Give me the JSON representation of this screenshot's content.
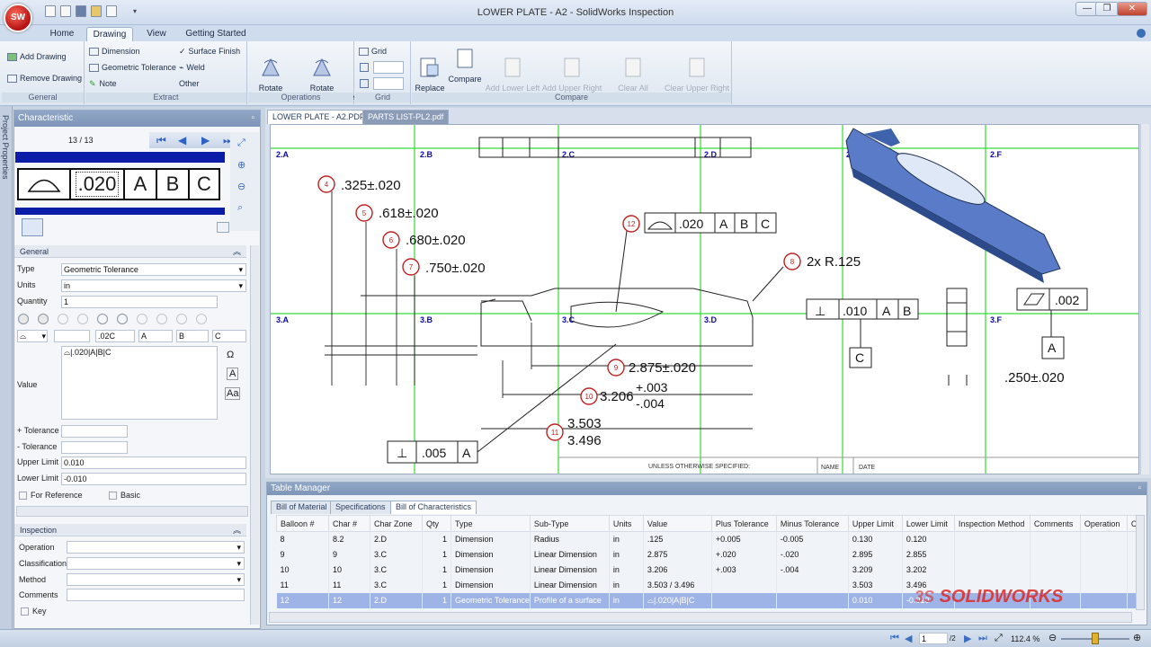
{
  "window": {
    "title": "LOWER PLATE - A2 - SolidWorks Inspection",
    "logo_text": "SW",
    "min": "—",
    "max": "❐",
    "close": "✕"
  },
  "ribbon": {
    "tabs": [
      "Home",
      "Drawing",
      "View",
      "Getting Started"
    ],
    "active_tab": "Drawing",
    "general": {
      "label": "General",
      "add_drawing": "Add Drawing",
      "remove_drawing": "Remove Drawing"
    },
    "extract": {
      "label": "Extract",
      "dimension": "Dimension",
      "geometric_tolerance": "Geometric Tolerance",
      "note": "Note",
      "surface_finish": "Surface Finish",
      "weld": "Weld",
      "other": "Other"
    },
    "operations": {
      "label": "Operations",
      "rotate_cw": "Rotate\nClockwise",
      "rotate_ccw": "Rotate\nCounterclockwise"
    },
    "grid": {
      "label": "Grid",
      "grid": "Grid"
    },
    "compare": {
      "label": "Compare",
      "replace_drawing": "Replace\nDrawing",
      "compare": "Compare",
      "add_lower_left": "Add Lower Left\nAlignment Point",
      "add_upper_right": "Add Upper Right\nAlignment Point",
      "clear_all": "Clear All\nAlignment Points",
      "clear_upper_right": "Clear Upper Right\nAlignment Point"
    }
  },
  "left_strip": {
    "label": "Project Properties"
  },
  "characteristic": {
    "header": "Characteristic",
    "pager": "13 / 13",
    "fcf": {
      "tolerance": ".020",
      "datum_a": "A",
      "datum_b": "B",
      "datum_c": "C"
    },
    "general_header": "General",
    "type_label": "Type",
    "type_value": "Geometric Tolerance",
    "units_label": "Units",
    "units_value": "in",
    "quantity_label": "Quantity",
    "quantity_value": "1",
    "fcf_row": {
      "tol": ".02C",
      "a": "A",
      "b": "B",
      "c": "C"
    },
    "value_label": "Value",
    "value_text": "⌓|.020|A|B|C",
    "plus_tol_label": "+ Tolerance",
    "minus_tol_label": "- Tolerance",
    "upper_label": "Upper Limit",
    "upper_value": "0.010",
    "lower_label": "Lower Limit",
    "lower_value": "-0.010",
    "for_reference": "For Reference",
    "basic": "Basic",
    "inspection_header": "Inspection",
    "operation_label": "Operation",
    "classification_label": "Classification",
    "method_label": "Method",
    "comments_label": "Comments",
    "key_label": "Key"
  },
  "doc_tabs": [
    "LOWER PLATE - A2.PDF",
    "PARTS LIST-PL2.pdf"
  ],
  "drawing": {
    "zones": [
      "2.A",
      "2.B",
      "2.C",
      "2.D",
      "2.E",
      "2.F",
      "3.A",
      "3.B",
      "3.C",
      "3.D",
      "3.F"
    ],
    "balloons": [
      {
        "n": "4",
        "text": ".325±.020"
      },
      {
        "n": "5",
        "text": ".618±.020"
      },
      {
        "n": "6",
        "text": ".680±.020"
      },
      {
        "n": "7",
        "text": ".750±.020"
      },
      {
        "n": "8",
        "text": "2x R.125"
      },
      {
        "n": "9",
        "text": "2.875±.020"
      },
      {
        "n": "10",
        "text": "3.206"
      },
      {
        "n": "11",
        "text": "3.503"
      },
      {
        "n": "12",
        "text": ""
      }
    ],
    "tol_10_plus": "+.003",
    "tol_10_minus": "-.004",
    "val_11_low": "3.496",
    "fcf12": {
      "tol": ".020",
      "a": "A",
      "b": "B",
      "c": "C"
    },
    "fcf_perp": {
      "tol": ".010",
      "a": "A",
      "b": "B"
    },
    "fcf_flat": {
      "tol": ".002"
    },
    "fcf_bottom": {
      "tol": ".005",
      "a": "A"
    },
    "datum_a": "A",
    "datum_c": "C",
    "dim_250": ".250±.020",
    "title_unless": "UNLESS OTHERWISE SPECIFIED:",
    "title_name": "NAME",
    "title_date": "DATE"
  },
  "table_manager": {
    "header": "Table Manager",
    "tabs": [
      "Bill of Material",
      "Specifications",
      "Bill of Characteristics"
    ],
    "active_tab": "Bill of Characteristics",
    "columns": [
      "Balloon #",
      "Char #",
      "Char Zone",
      "Qty",
      "Type",
      "Sub-Type",
      "Units",
      "Value",
      "Plus Tolerance",
      "Minus Tolerance",
      "Upper Limit",
      "Lower Limit",
      "Inspection Method",
      "Comments",
      "Operation",
      "C"
    ],
    "rows": [
      [
        "8",
        "8.2",
        "2.D",
        "1",
        "Dimension",
        "Radius",
        "in",
        ".125",
        "+0.005",
        "-0.005",
        "0.130",
        "0.120",
        "",
        "",
        "",
        ""
      ],
      [
        "9",
        "9",
        "3.C",
        "1",
        "Dimension",
        "Linear Dimension",
        "in",
        "2.875",
        "+.020",
        "-.020",
        "2.895",
        "2.855",
        "",
        "",
        "",
        ""
      ],
      [
        "10",
        "10",
        "3.C",
        "1",
        "Dimension",
        "Linear Dimension",
        "in",
        "3.206",
        "+.003",
        "-.004",
        "3.209",
        "3.202",
        "",
        "",
        "",
        ""
      ],
      [
        "11",
        "11",
        "3.C",
        "1",
        "Dimension",
        "Linear Dimension",
        "in",
        "3.503 / 3.496",
        "",
        "",
        "3.503",
        "3.496",
        "",
        "",
        "",
        ""
      ],
      [
        "12",
        "12",
        "2.D",
        "1",
        "Geometric Tolerance",
        "Profile of a surface",
        "in",
        "⌓|.020|A|B|C",
        "",
        "",
        "0.010",
        "-0.010",
        "",
        "",
        "",
        ""
      ]
    ],
    "selected_row": 4
  },
  "status": {
    "page_value": "1",
    "page_total": "/2",
    "zoom": "112.4 %"
  },
  "brand": {
    "watermark": "SOLIDWORKS",
    "ds": "3S"
  }
}
